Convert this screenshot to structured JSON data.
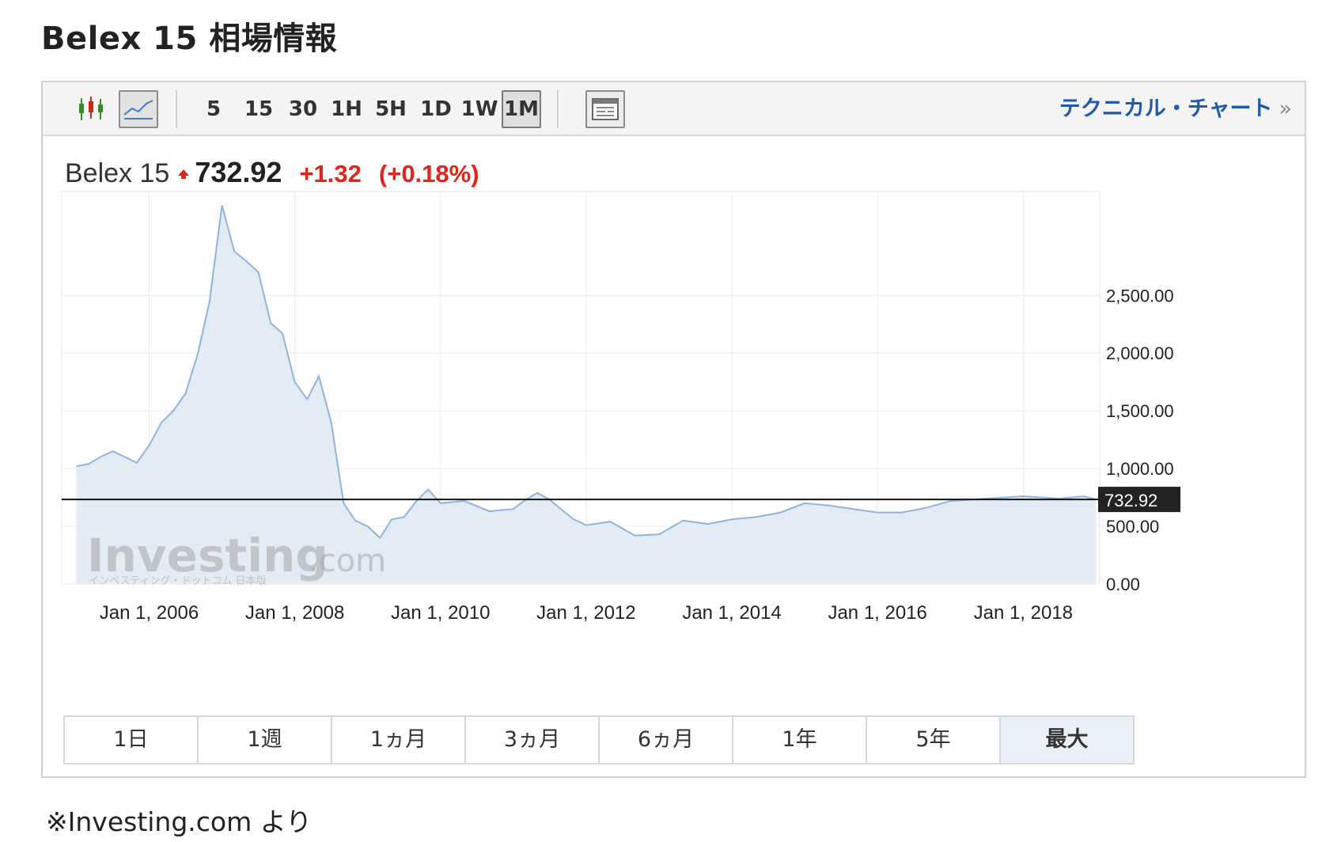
{
  "page": {
    "title": "Belex 15 相場情報",
    "source_note": "※Investing.com より"
  },
  "toolbar": {
    "intervals": [
      "5",
      "15",
      "30",
      "1H",
      "5H",
      "1D",
      "1W",
      "1M"
    ],
    "active_interval": "1M",
    "technical_chart_link": "テクニカル・チャート",
    "link_chevron": "»"
  },
  "quote": {
    "name": "Belex 15",
    "price": "732.92",
    "change": "+1.32",
    "change_pct": "(+0.18%)",
    "direction": "up"
  },
  "watermark": {
    "brand": "Investing",
    "suffix": ".com",
    "tagline": "インベスティング・ドットコム 日本版"
  },
  "ranges": {
    "items": [
      "1日",
      "1週",
      "1ヵ月",
      "3ヵ月",
      "6ヵ月",
      "1年",
      "5年",
      "最大"
    ],
    "active": "最大"
  },
  "colors": {
    "line": "#8fb4dc",
    "fill": "#e3ebf5",
    "price_line": "#111111",
    "up": "#e0261b",
    "link": "#1f5ba8"
  },
  "chart_data": {
    "type": "area",
    "series": [
      {
        "x": [
          2005.0,
          2005.17,
          2005.33,
          2005.5,
          2005.67,
          2005.83,
          2006.0,
          2006.17,
          2006.33,
          2006.5,
          2006.67,
          2006.83,
          2007.0,
          2007.17,
          2007.33,
          2007.5,
          2007.67,
          2007.83,
          2008.0,
          2008.17,
          2008.33,
          2008.5,
          2008.67,
          2008.83,
          2009.0,
          2009.17,
          2009.33,
          2009.5,
          2009.67,
          2009.83,
          2010.0,
          2010.33,
          2010.67,
          2011.0,
          2011.17,
          2011.33,
          2011.5,
          2011.67,
          2011.83,
          2012.0,
          2012.33,
          2012.67,
          2013.0,
          2013.33,
          2013.67,
          2014.0,
          2014.33,
          2014.67,
          2015.0,
          2015.33,
          2015.67,
          2016.0,
          2016.33,
          2016.67,
          2017.0,
          2017.5,
          2018.0,
          2018.5,
          2018.83,
          2019.0
        ],
        "y": [
          1020,
          1040,
          1100,
          1150,
          1100,
          1050,
          1200,
          1400,
          1500,
          1650,
          2000,
          2450,
          3280,
          2880,
          2800,
          2700,
          2260,
          2170,
          1750,
          1600,
          1800,
          1400,
          700,
          550,
          500,
          400,
          560,
          580,
          720,
          820,
          700,
          720,
          630,
          650,
          730,
          790,
          730,
          640,
          560,
          510,
          540,
          420,
          430,
          550,
          520,
          560,
          580,
          620,
          700,
          680,
          650,
          620,
          620,
          660,
          720,
          740,
          760,
          740,
          760,
          732.92
        ]
      }
    ],
    "current_value": 732.92,
    "y_ticks": [
      "0.00",
      "500.00",
      "1,000.00",
      "1,500.00",
      "2,000.00",
      "2,500.00"
    ],
    "y_tick_values": [
      0,
      500,
      1000,
      1500,
      2000,
      2500
    ],
    "x_ticks": [
      "Jan 1, 2006",
      "Jan 1, 2008",
      "Jan 1, 2010",
      "Jan 1, 2012",
      "Jan 1, 2014",
      "Jan 1, 2016",
      "Jan 1, 2018"
    ],
    "x_tick_values": [
      2006,
      2008,
      2010,
      2012,
      2014,
      2016,
      2018
    ],
    "xlim": [
      2004.8,
      2019.05
    ],
    "ylim": [
      0,
      3400
    ],
    "grid": true
  }
}
